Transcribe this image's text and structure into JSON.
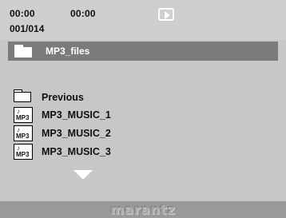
{
  "status": {
    "elapsed_time": "00:00",
    "total_time": "00:00",
    "track_counter": "001/014"
  },
  "header": {
    "folder_name": "MP3_files"
  },
  "list": {
    "items": [
      {
        "type": "folder",
        "label": "Previous"
      },
      {
        "type": "mp3",
        "label": "MP3_MUSIC_1"
      },
      {
        "type": "mp3",
        "label": "MP3_MUSIC_2"
      },
      {
        "type": "mp3",
        "label": "MP3_MUSIC_3"
      }
    ]
  },
  "icons": {
    "play": "play-icon",
    "folder": "folder-icon",
    "mp3": "mp3-file-icon",
    "scroll_down": "down-arrow-icon"
  },
  "mp3_icon_text": "MP3",
  "brand": "marantz"
}
